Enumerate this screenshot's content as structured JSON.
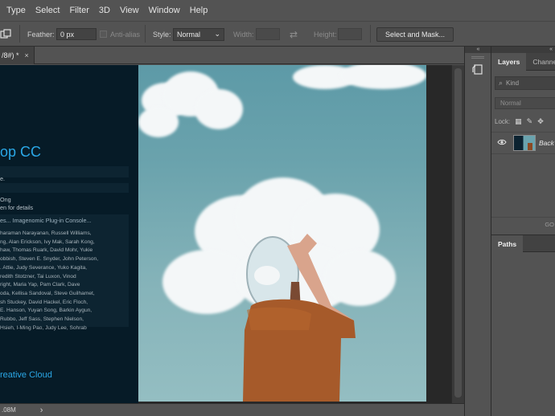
{
  "menu": [
    "Type",
    "Select",
    "Filter",
    "3D",
    "View",
    "Window",
    "Help"
  ],
  "options": {
    "feather_label": "Feather:",
    "feather_value": "0 px",
    "antialias_label": "Anti-alias",
    "style_label": "Style:",
    "style_value": "Normal",
    "width_label": "Width:",
    "height_label": "Height:",
    "select_mask_label": "Select and Mask..."
  },
  "document": {
    "tab_title": "/8#) *",
    "close_glyph": "×"
  },
  "splash": {
    "title": "op CC",
    "line1": "e.",
    "line2": "Ong",
    "line3": "en for details",
    "plugin_line": "es... Imagenomic Plug-in Console...",
    "credits": [
      "haraman Narayanan, Russell Williams,",
      "ng, Alan Erickson, Ivy Mak, Sarah Kong,",
      "haw, Thomas Ruark, David Mohr, Yukie",
      "obbish, Steven E. Snyder, John Peterson,",
      ". Attie, Judy Severance, Yuko Kagita,",
      "redith Stotzner, Tai Luxon, Vinod",
      "right, Maria Yap, Pam Clark, Dave",
      "oda, Kellisa Sandoval, Steve Guilhamet,",
      "sh Stuckey, David Hackel, Eric Floch,",
      "E. Hanson, Yuyan Song, Barkin Aygun,",
      "Rubbo, Jeff Sass, Stephen Nielson,",
      "Hsieh, I-Ming Pao, Judy Lee, Sohrab"
    ],
    "footer": "reative Cloud"
  },
  "status": {
    "doc_size": ".08M",
    "arrow": "›"
  },
  "panels": {
    "collapse_arrows": "«",
    "dock_arrows": "«",
    "layers_tab": "Layers",
    "channels_tab": "Channel",
    "kind_label": "Kind",
    "blend_mode": "Normal",
    "lock_label": "Lock:",
    "layer_name": "Back",
    "footer_text": "GO",
    "paths_tab": "Paths"
  }
}
